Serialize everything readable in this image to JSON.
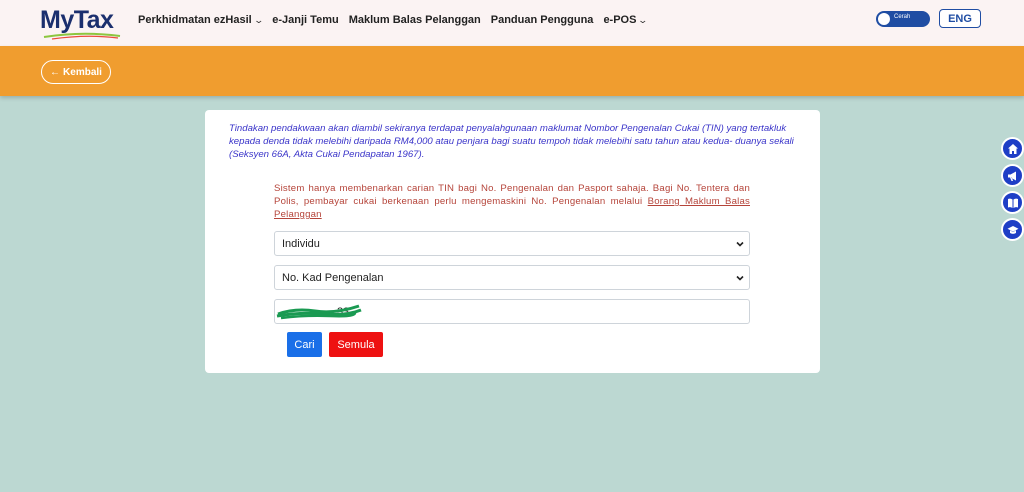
{
  "header": {
    "logo_text": "MyTax",
    "nav": [
      {
        "label": "Perkhidmatan ezHasil",
        "has_dropdown": true
      },
      {
        "label": "e-Janji Temu",
        "has_dropdown": false
      },
      {
        "label": "Maklum Balas Pelanggan",
        "has_dropdown": false
      },
      {
        "label": "Panduan Pengguna",
        "has_dropdown": false
      },
      {
        "label": "e-POS",
        "has_dropdown": true
      }
    ],
    "theme_toggle_label": "Cerah",
    "language_button": "ENG"
  },
  "band": {
    "back_label": "Kembali"
  },
  "form": {
    "warning_text": "Tindakan pendakwaan akan diambil sekiranya terdapat penyalahgunaan maklumat Nombor Pengenalan Cukai (TIN) yang tertakluk kepada denda tidak melebihi daripada RM4,000 atau penjara bagi suatu tempoh tidak melebihi satu tahun atau kedua- duanya sekali (Seksyen 66A, Akta Cukai Pendapatan 1967).",
    "notice_text": "Sistem hanya membenarkan carian TIN bagi No. Pengenalan dan Pasport sahaja. Bagi No. Tentera dan Polis, pembayar cukai berkenaan perlu mengemaskini No. Pengenalan melalui",
    "notice_link": "Borang Maklum Balas Pelanggan",
    "category_select": "Individu",
    "id_type_select": "No. Kad Pengenalan",
    "id_input_visible_fragment": "33",
    "search_button": "Cari",
    "reset_button": "Semula"
  },
  "colors": {
    "page_bg": "#bcd8d2",
    "header_bg": "#fbf3f3",
    "band_bg": "#f09d2f",
    "primary": "#1a6fe8",
    "danger": "#ee1111",
    "warning_text": "#3a34c9",
    "notice_text": "#b5443a",
    "side_icons": "#1e3ec6"
  },
  "side_icons": [
    "home-icon",
    "megaphone-icon",
    "book-icon",
    "graduation-cap-icon"
  ]
}
